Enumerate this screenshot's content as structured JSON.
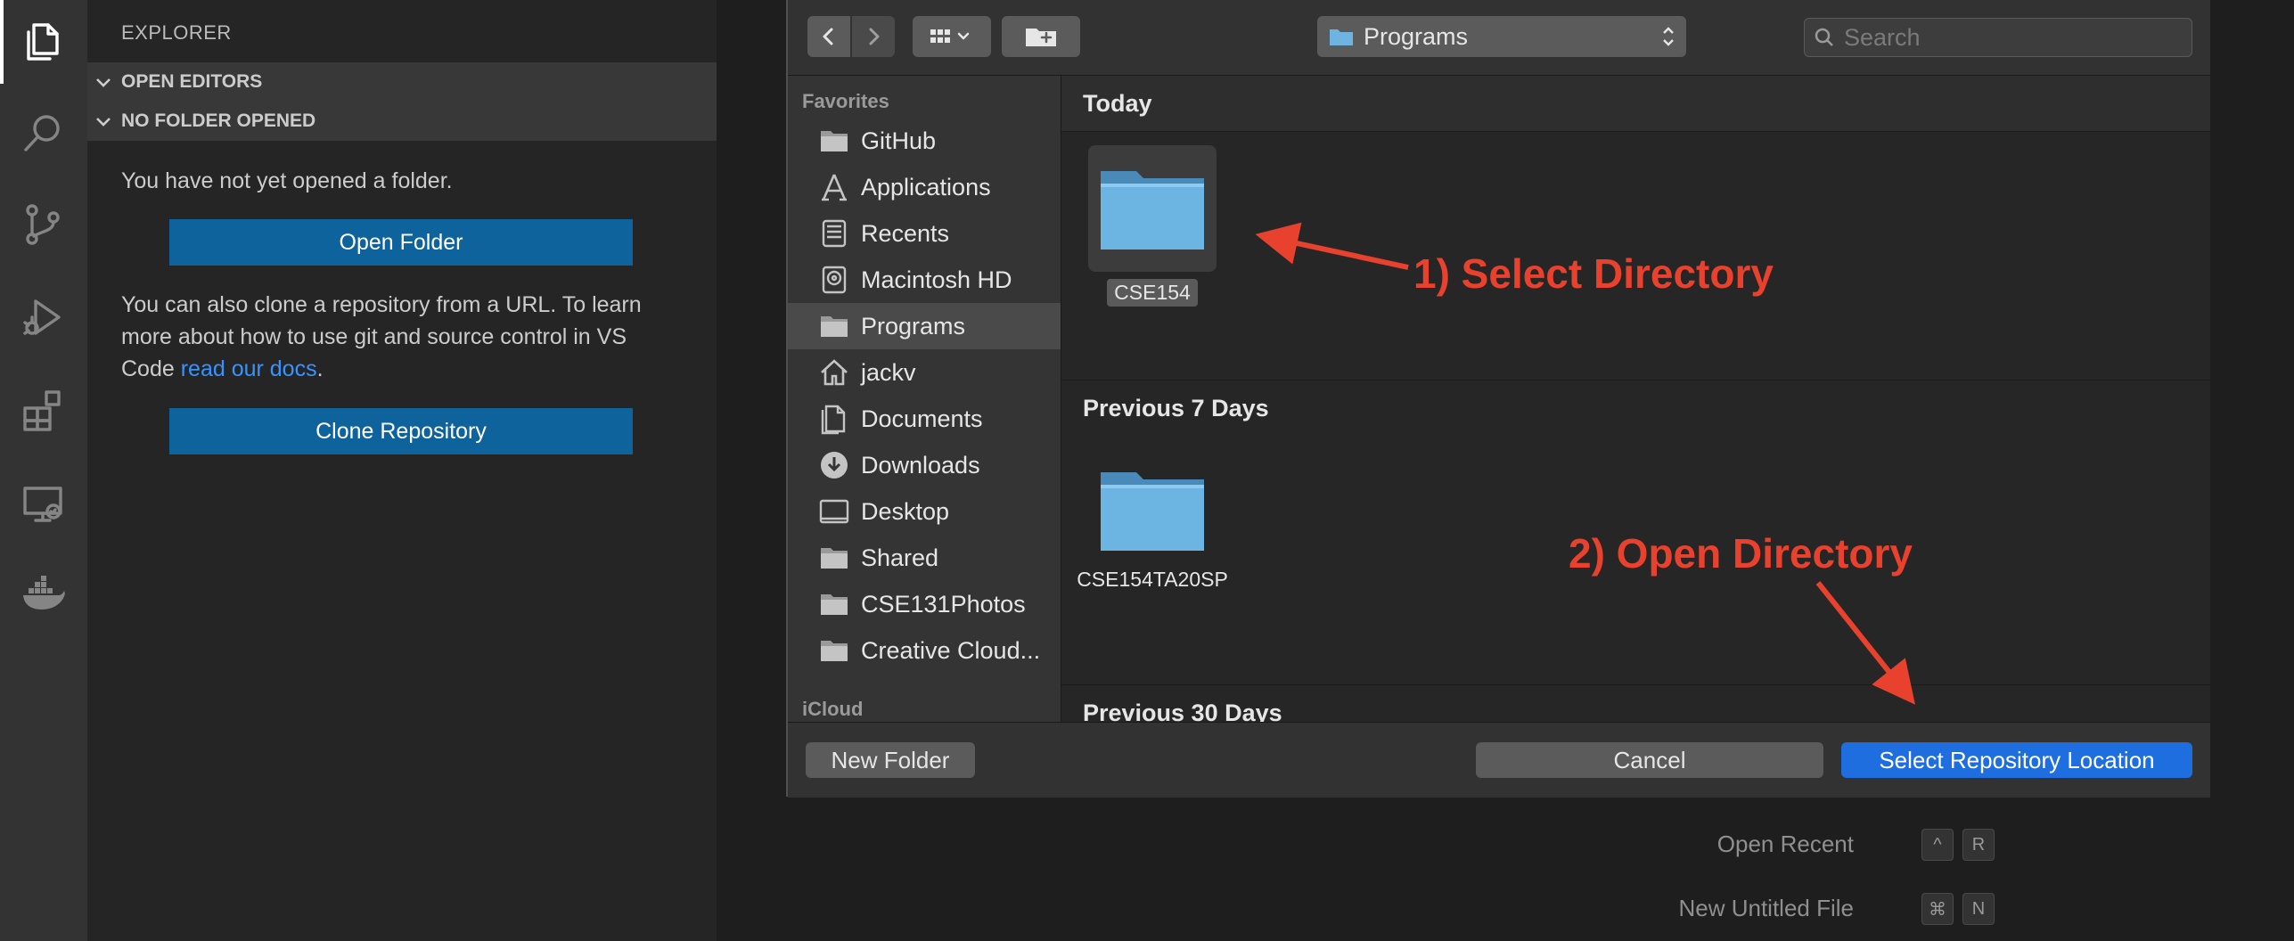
{
  "activity_bar": {
    "icons": [
      "files-icon",
      "search-icon",
      "source-control-icon",
      "run-debug-icon",
      "extensions-icon",
      "remote-explorer-icon",
      "docker-icon"
    ]
  },
  "sidebar": {
    "title": "EXPLORER",
    "open_editors": "OPEN EDITORS",
    "no_folder": "NO FOLDER OPENED",
    "message": "You have not yet opened a folder.",
    "open_folder_button": "Open Folder",
    "clone_text_before": "You can also clone a repository from a URL. To learn more about how to use git and source control in VS Code ",
    "clone_link": "read our docs",
    "clone_text_after": ".",
    "clone_button": "Clone Repository"
  },
  "editor": {
    "hints": [
      {
        "label": "Open Recent",
        "keys": [
          "^",
          "R"
        ]
      },
      {
        "label": "New Untitled File",
        "keys": [
          "⌘",
          "N"
        ]
      }
    ]
  },
  "dialog": {
    "path": "Programs",
    "search_placeholder": "Search",
    "sidebar": {
      "favorites_header": "Favorites",
      "favorites": [
        {
          "label": "GitHub",
          "icon": "folder-icon"
        },
        {
          "label": "Applications",
          "icon": "applications-icon"
        },
        {
          "label": "Recents",
          "icon": "recents-icon"
        },
        {
          "label": "Macintosh HD",
          "icon": "hard-drive-icon"
        },
        {
          "label": "Programs",
          "icon": "folder-icon",
          "selected": true
        },
        {
          "label": "jackv",
          "icon": "home-icon"
        },
        {
          "label": "Documents",
          "icon": "documents-icon"
        },
        {
          "label": "Downloads",
          "icon": "downloads-icon"
        },
        {
          "label": "Desktop",
          "icon": "desktop-icon"
        },
        {
          "label": "Shared",
          "icon": "folder-icon"
        },
        {
          "label": "CSE131Photos",
          "icon": "folder-icon"
        },
        {
          "label": "Creative Cloud...",
          "icon": "folder-icon"
        }
      ],
      "icloud_header": "iCloud"
    },
    "groups": [
      {
        "title": "Today",
        "items": [
          {
            "name": "CSE154",
            "selected": true
          }
        ]
      },
      {
        "title": "Previous 7 Days",
        "items": [
          {
            "name": "CSE154TA20SP",
            "selected": false
          }
        ]
      },
      {
        "title": "Previous 30 Days",
        "items": []
      }
    ],
    "footer": {
      "new_folder": "New Folder",
      "cancel": "Cancel",
      "confirm": "Select Repository Location"
    }
  },
  "annotations": {
    "step1": "1) Select Directory",
    "step2": "2) Open Directory",
    "color": "#e8412d"
  }
}
